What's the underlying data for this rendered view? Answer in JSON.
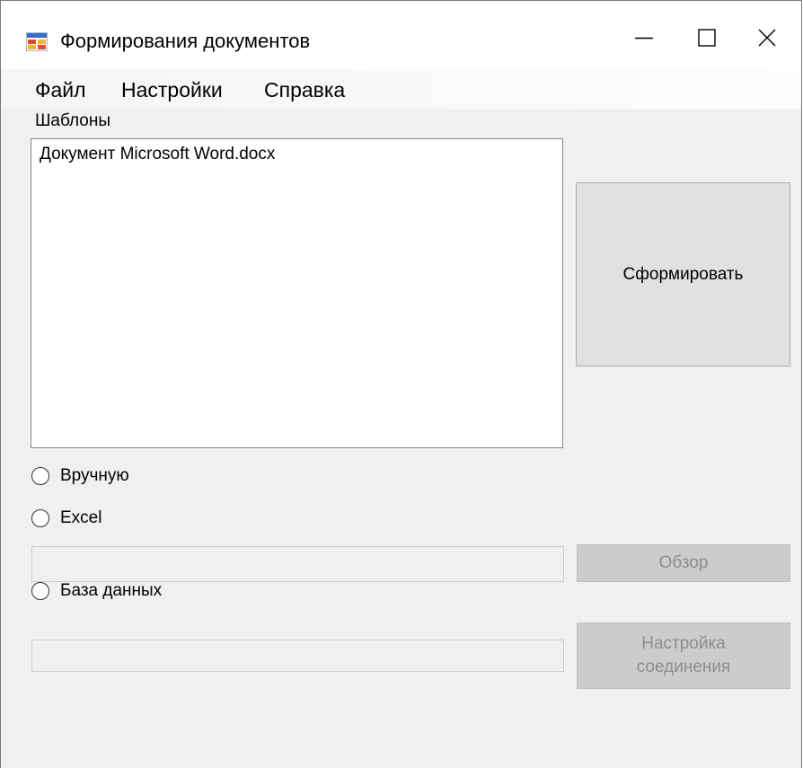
{
  "window": {
    "title": "Формирования документов",
    "controls": {
      "minimize_icon": "minimize-icon",
      "maximize_icon": "maximize-icon",
      "close_icon": "close-icon"
    }
  },
  "menu": {
    "items": [
      {
        "label": "Файл"
      },
      {
        "label": "Настройки"
      },
      {
        "label": "Справка"
      }
    ]
  },
  "templates": {
    "label": "Шаблоны",
    "items": [
      "Документ Microsoft Word.docx"
    ]
  },
  "buttons": {
    "generate": "Сформировать",
    "browse": "Обзор",
    "connection": "Настройка\nсоединения"
  },
  "source": {
    "options": [
      {
        "label": "Вручную",
        "checked": false
      },
      {
        "label": "Excel",
        "checked": false
      },
      {
        "label": "База данных",
        "checked": false
      }
    ],
    "excel_path": "",
    "db_connection": ""
  },
  "colors": {
    "window_bg": "#f0f0f0",
    "button_bg": "#e1e1e1",
    "button_disabled_bg": "#cccccc",
    "disabled_text": "#8d8d8d"
  }
}
